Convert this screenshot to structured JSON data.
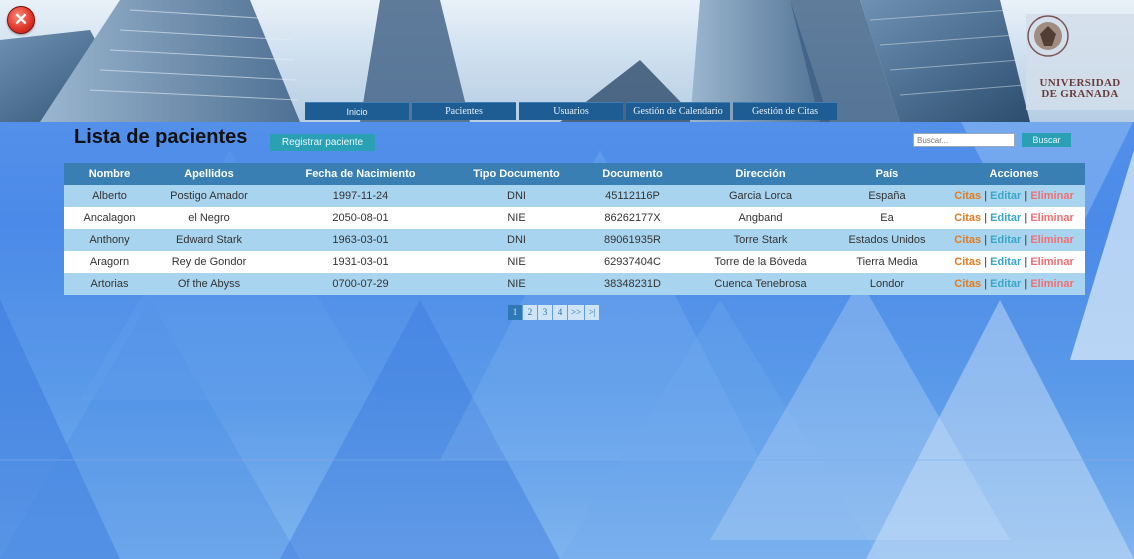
{
  "header": {
    "close_icon": "close-icon",
    "logo_text_line1": "UNIVERSIDAD",
    "logo_text_line2": "DE GRANADA"
  },
  "nav": {
    "items": [
      "Inicio",
      "Pacientes",
      "Usuarios",
      "Gestión de Calendario",
      "Gestión de Citas"
    ]
  },
  "main": {
    "title": "Lista de pacientes",
    "register_button": "Registrar paciente",
    "search_placeholder": "Buscar...",
    "search_button": "Buscar"
  },
  "table": {
    "columns": [
      "Nombre",
      "Apellidos",
      "Fecha de Nacimiento",
      "Tipo Documento",
      "Documento",
      "Dirección",
      "País",
      "Acciones"
    ],
    "rows": [
      [
        "Alberto",
        "Postigo Amador",
        "1997-11-24",
        "DNI",
        "45112116P",
        "Garcia Lorca",
        "España"
      ],
      [
        "Ancalagon",
        "el Negro",
        "2050-08-01",
        "NIE",
        "86262177X",
        "Angband",
        "Ea"
      ],
      [
        "Anthony",
        "Edward Stark",
        "1963-03-01",
        "DNI",
        "89061935R",
        "Torre Stark",
        "Estados Unidos"
      ],
      [
        "Aragorn",
        "Rey de Gondor",
        "1931-03-01",
        "NIE",
        "62937404C",
        "Torre de la Bóveda",
        "Tierra Media"
      ],
      [
        "Artorias",
        "Of the Abyss",
        "0700-07-29",
        "NIE",
        "38348231D",
        "Cuenca Tenebrosa",
        "Londor"
      ]
    ],
    "actions": {
      "citas": "Citas",
      "editar": "Editar",
      "eliminar": "Eliminar",
      "separator": "|"
    }
  },
  "pagination": {
    "pages": [
      "1",
      "2",
      "3",
      "4",
      ">>",
      ">|"
    ],
    "active": "1"
  },
  "colors": {
    "header_row": "#3a7fb3",
    "odd_row": "#a9d4ef",
    "button": "#2aa0b5",
    "nav": "#1e5d93",
    "citas": "#e37b1f",
    "editar": "#3aa6c6",
    "eliminar": "#ef6f73"
  }
}
